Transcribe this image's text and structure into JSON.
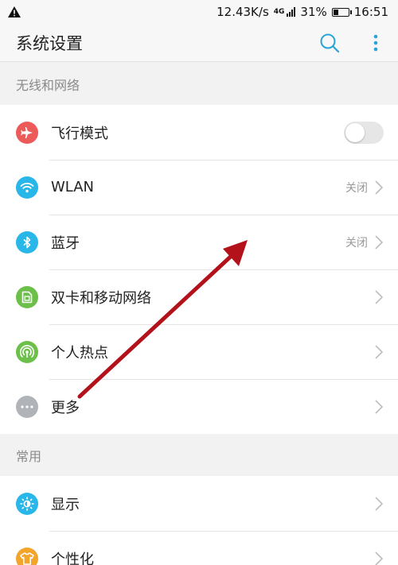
{
  "status_bar": {
    "warning_icon": "warning-icon",
    "net_speed": "12.43K/s",
    "network_type": "4G",
    "battery_percent": "31%",
    "battery_level": 0.31,
    "time": "16:51"
  },
  "app_bar": {
    "title": "系统设置",
    "search_icon": "search-icon",
    "more_icon": "more-vertical-icon"
  },
  "sections": {
    "wireless": {
      "header": "无线和网络",
      "items": [
        {
          "label": "飞行模式",
          "icon": "airplane-icon",
          "color": "#ec5a5a",
          "control": "toggle",
          "toggle_on": false
        },
        {
          "label": "WLAN",
          "icon": "wifi-icon",
          "color": "#29b6e8",
          "value": "关闭"
        },
        {
          "label": "蓝牙",
          "icon": "bluetooth-icon",
          "color": "#29b6e8",
          "value": "关闭"
        },
        {
          "label": "双卡和移动网络",
          "icon": "sim-card-icon",
          "color": "#6cc04a"
        },
        {
          "label": "个人热点",
          "icon": "hotspot-icon",
          "color": "#6cc04a"
        },
        {
          "label": "更多",
          "icon": "more-horizontal-icon",
          "color": "#b0b3b8"
        }
      ]
    },
    "common": {
      "header": "常用",
      "items": [
        {
          "label": "显示",
          "icon": "brightness-icon",
          "color": "#29b6e8"
        },
        {
          "label": "个性化",
          "icon": "tshirt-icon",
          "color": "#f3a42a"
        }
      ]
    }
  },
  "colors": {
    "accent": "#29a3d8",
    "annotation_arrow": "#b3121b",
    "chevron": "#bdbdbd"
  }
}
